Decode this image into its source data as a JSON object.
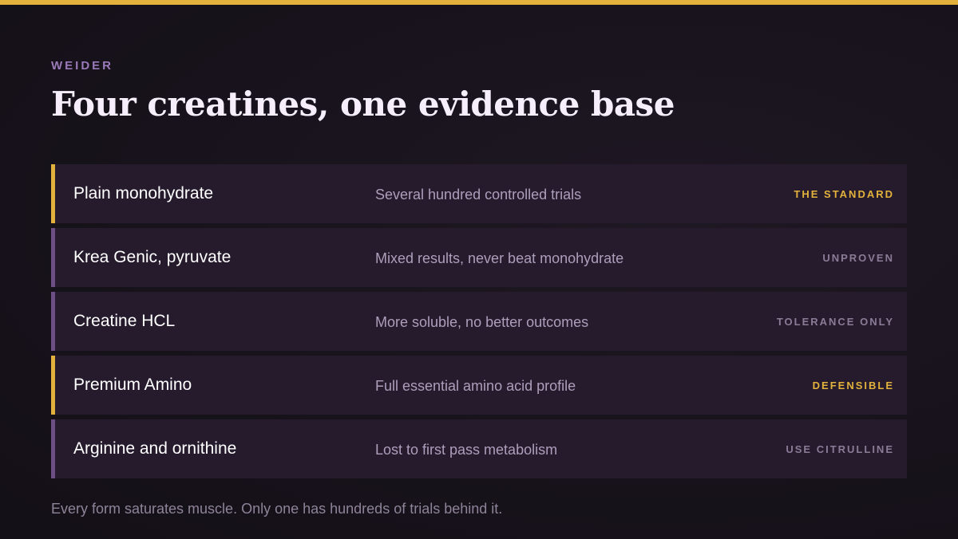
{
  "brand": "WEIDER",
  "title": "Four creatines, one evidence base",
  "accent_color": "#e3b23c",
  "muted_accent_color": "#6e4f85",
  "rows": [
    {
      "name": "Plain monohydrate",
      "description": "Several hundred controlled trials",
      "tag": "THE STANDARD",
      "highlight": true
    },
    {
      "name": "Krea Genic, pyruvate",
      "description": "Mixed results, never beat monohydrate",
      "tag": "UNPROVEN",
      "highlight": false
    },
    {
      "name": "Creatine HCL",
      "description": "More soluble, no better outcomes",
      "tag": "TOLERANCE ONLY",
      "highlight": false
    },
    {
      "name": "Premium Amino",
      "description": "Full essential amino acid profile",
      "tag": "DEFENSIBLE",
      "highlight": true
    },
    {
      "name": "Arginine and ornithine",
      "description": "Lost to first pass metabolism",
      "tag": "USE CITRULLINE",
      "highlight": false
    }
  ],
  "footer": "Every form saturates muscle. Only one has hundreds of trials behind it."
}
